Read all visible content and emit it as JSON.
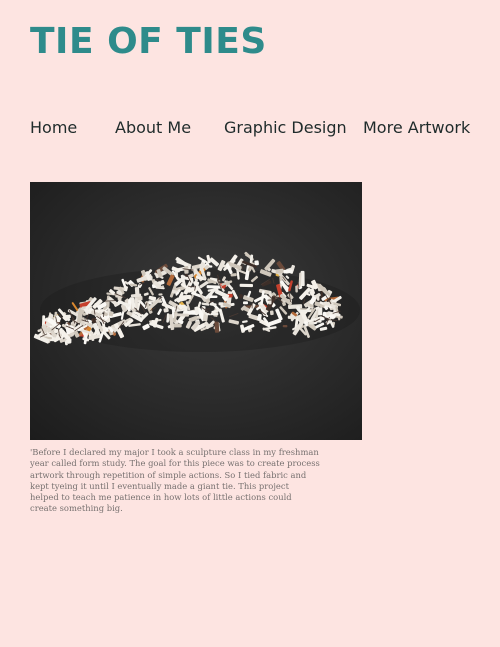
{
  "site": {
    "title": "TIE OF TIES"
  },
  "nav": {
    "items": [
      {
        "label": "Home"
      },
      {
        "label": "About Me"
      },
      {
        "label": "Graphic Design"
      },
      {
        "label": "More Artwork"
      }
    ]
  },
  "artwork": {
    "caption": "'Before I declared my major I took a sculpture class in my freshman year called form study. The goal for this piece was to create process artwork through repetition of simple actions. So I tied fabric and kept tyeing it until I eventually made a giant tie. This project helped to teach me patience in how lots of little actions could create something big."
  },
  "colors": {
    "background": "#fde4e1",
    "title": "#2e8b8b",
    "nav_text": "#1f2b2b",
    "caption_text": "#777170"
  }
}
